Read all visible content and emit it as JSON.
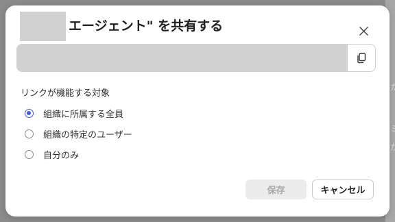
{
  "dialog": {
    "title": "エージェント\" を共有する",
    "link_value": "",
    "section_label": "リンクが機能する対象",
    "options": [
      {
        "label": "組織に所属する全員",
        "checked": true
      },
      {
        "label": "組織の特定のユーザー",
        "checked": false
      },
      {
        "label": "自分のみ",
        "checked": false
      }
    ],
    "save_label": "保存",
    "cancel_label": "キャンセル"
  },
  "background": {
    "fragments": [
      "た",
      "ミ",
      "が"
    ]
  },
  "icons": {
    "close": "close-icon",
    "copy": "copy-icon"
  },
  "colors": {
    "accent": "#3b5bdb",
    "overlay": "#8b8b8b",
    "redacted": "#d1d1d1"
  }
}
